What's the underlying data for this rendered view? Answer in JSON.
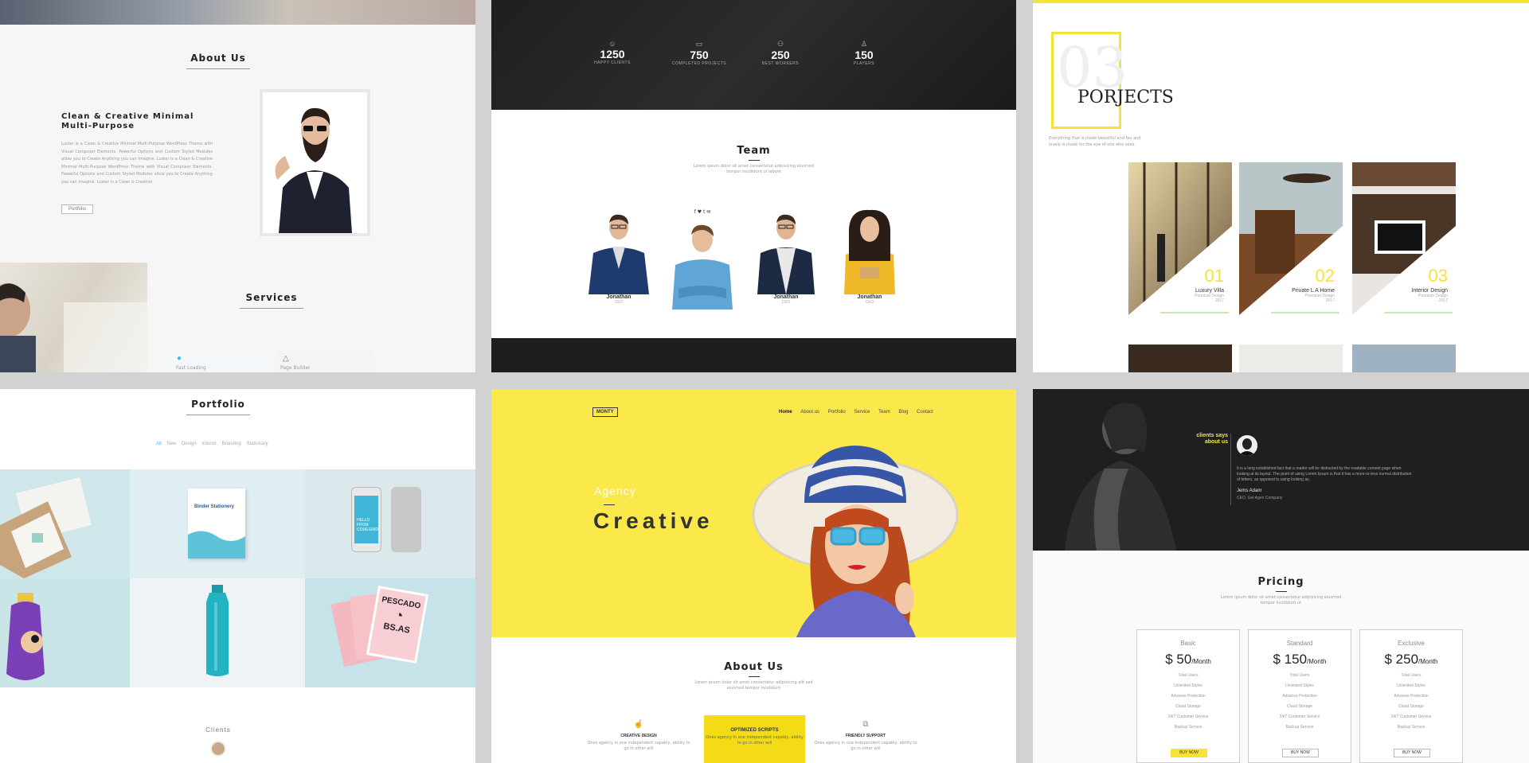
{
  "colors": {
    "yellow": "#f7e338",
    "dark": "#2b2b2b",
    "grey_bg": "#d2d2d2"
  },
  "panel1": {
    "about_title": "About Us",
    "headline": "Clean & Creative Minimal Multi-Purpose",
    "body": "Luster is a Clean & Creative Minimal Multi-Purpose WordPress Theme with Visual Composer Elements. Powerful Options and Custom Styled Modules allow you to Create Anything you can Imagine. Luster is a Clean & Creative Minimal Multi-Purpose WordPress Theme with Visual Composer Elements. Powerful Options and Custom Styled Modules allow you to Create Anything you can Imagine. Luster is a Clean & Creative",
    "button": "Portfolio",
    "services_title": "Services",
    "service_items": [
      "Fast Loading",
      "Page Builder"
    ]
  },
  "panel2": {
    "stats": [
      {
        "value": "1250",
        "label": "HAPPY CLIENTS",
        "icon": "smile-icon"
      },
      {
        "value": "750",
        "label": "COMPLETED PROJECTS",
        "icon": "monitor-icon"
      },
      {
        "value": "250",
        "label": "BEST WORKERS",
        "icon": "users-icon"
      },
      {
        "value": "150",
        "label": "PLAYERS",
        "icon": "person-icon"
      }
    ],
    "team_title": "Team",
    "team_sub": "Lorem ipsum dolor sit amet consectetur adipisicing eiusmod tempor incididunt ut labore",
    "social": "f  ♥  t  ✉",
    "members": [
      {
        "name": "Jonathan",
        "role": "CEO"
      },
      {
        "name": "",
        "role": ""
      },
      {
        "name": "Jonathan",
        "role": "CEO"
      },
      {
        "name": "Jonathan",
        "role": "CEO"
      }
    ]
  },
  "panel3": {
    "big_num": "03",
    "title": "PORJECTS",
    "desc": "Everything that is made beautiful and fan and lovely is made for the eye of one who sees.",
    "projects": [
      {
        "num": "01",
        "title": "Luxury Villa",
        "sub": "Premium Design",
        "year": "2017"
      },
      {
        "num": "02",
        "title": "Private L A Home",
        "sub": "Premium Design",
        "year": "2017"
      },
      {
        "num": "03",
        "title": "Interior Design",
        "sub": "Premium Design",
        "year": "2017"
      }
    ]
  },
  "panel4": {
    "title": "Portfolio",
    "filters": [
      "All",
      "New",
      "Design",
      "Interior",
      "Branding",
      "Stationary"
    ],
    "items": [
      "Binder Stationery",
      "HELLO FROM CODEGRID",
      "PESCADO",
      "BS.AS"
    ],
    "clients_title": "Clients"
  },
  "panel5": {
    "logo": "MONTY",
    "nav": [
      "Home",
      "About us",
      "Portfolio",
      "Service",
      "Team",
      "Blog",
      "Contact"
    ],
    "agency": "Agency",
    "creative": "Creative",
    "about_title": "About Us",
    "about_sub": "Lorem ipsum dolor sit amet consectetur adipisicing elit sed eiusmod tempor incididunt",
    "features": [
      {
        "title": "CREATIVE DESIGN",
        "text": "Ones agency in one independent capably, ability to go in other will"
      },
      {
        "title": "OPTIMIZED SCRIPTS",
        "text": "Ones agency in one independent capably, ability to go in other will"
      },
      {
        "title": "FRIENDLY SUPPORT",
        "text": "Ones agency in one independent capably, ability to go in other will"
      }
    ]
  },
  "panel6": {
    "clients_says": "clients says about us",
    "quote": "It is a long established fact that a reader will be distracted by the readable content page when looking at its layout. The point of using Lorem Ipsum is that it has a more-or-less normal distribution of letters, as opposed to using looking as.",
    "author": "Jems Adam",
    "company": "CEO, Get Agen Company",
    "pricing_title": "Pricing",
    "pricing_sub": "Lorem ipsum dolor sit amet consectetur adipisicing eiusmod tempor incididunt ut",
    "plans": [
      {
        "name": "Basic",
        "price": "$ 50",
        "per": "/Month",
        "button": "BUY NOW"
      },
      {
        "name": "Standard",
        "price": "$ 150",
        "per": "/Month",
        "button": "BUY NOW"
      },
      {
        "name": "Exclusive",
        "price": "$ 250",
        "per": "/Month",
        "button": "BUY NOW"
      }
    ],
    "features": [
      "Total Users",
      "Unlimited Styles",
      "Advance Protection",
      "Cloud Storage",
      "24/7 Customer Service",
      "Backup Service"
    ]
  }
}
